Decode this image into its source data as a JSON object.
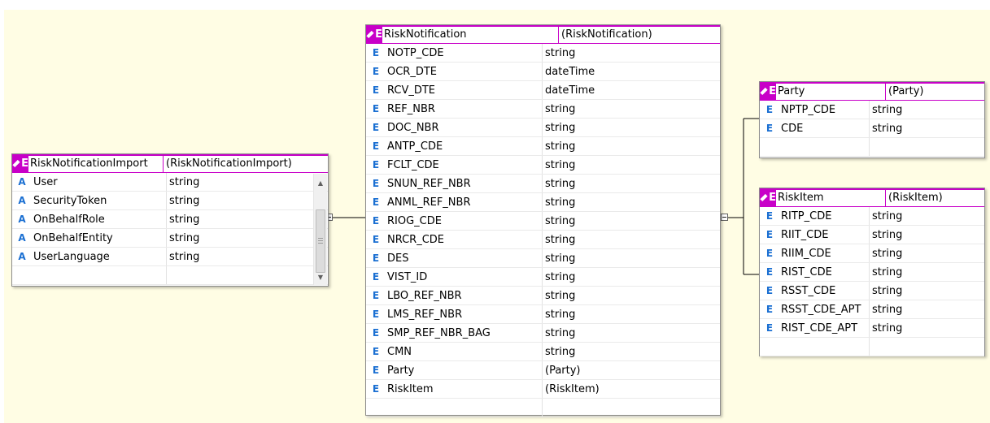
{
  "colors": {
    "canvas": "#fffde4",
    "header": "#c800c8",
    "element_icon": "#1a6fd2",
    "attribute_icon": "#1a6fd2"
  },
  "nodes": {
    "import": {
      "header_icon": "E",
      "name": "RiskNotificationImport",
      "type": "(RiskNotificationImport)",
      "rows": [
        {
          "icon": "A",
          "name": "User",
          "type": "string"
        },
        {
          "icon": "A",
          "name": "SecurityToken",
          "type": "string"
        },
        {
          "icon": "A",
          "name": "OnBehalfRole",
          "type": "string"
        },
        {
          "icon": "A",
          "name": "OnBehalfEntity",
          "type": "string"
        },
        {
          "icon": "A",
          "name": "UserLanguage",
          "type": "string"
        }
      ]
    },
    "notification": {
      "header_icon": "E",
      "name": "RiskNotification",
      "type": "(RiskNotification)",
      "rows": [
        {
          "icon": "E",
          "name": "NOTP_CDE",
          "type": "string"
        },
        {
          "icon": "E",
          "name": "OCR_DTE",
          "type": "dateTime"
        },
        {
          "icon": "E",
          "name": "RCV_DTE",
          "type": "dateTime"
        },
        {
          "icon": "E",
          "name": "REF_NBR",
          "type": "string"
        },
        {
          "icon": "E",
          "name": "DOC_NBR",
          "type": "string"
        },
        {
          "icon": "E",
          "name": "ANTP_CDE",
          "type": "string"
        },
        {
          "icon": "E",
          "name": "FCLT_CDE",
          "type": "string"
        },
        {
          "icon": "E",
          "name": "SNUN_REF_NBR",
          "type": "string"
        },
        {
          "icon": "E",
          "name": "ANML_REF_NBR",
          "type": "string"
        },
        {
          "icon": "E",
          "name": "RIOG_CDE",
          "type": "string"
        },
        {
          "icon": "E",
          "name": "NRCR_CDE",
          "type": "string"
        },
        {
          "icon": "E",
          "name": "DES",
          "type": "string"
        },
        {
          "icon": "E",
          "name": "VIST_ID",
          "type": "string"
        },
        {
          "icon": "E",
          "name": "LBO_REF_NBR",
          "type": "string"
        },
        {
          "icon": "E",
          "name": "LMS_REF_NBR",
          "type": "string"
        },
        {
          "icon": "E",
          "name": "SMP_REF_NBR_BAG",
          "type": "string"
        },
        {
          "icon": "E",
          "name": "CMN",
          "type": "string"
        },
        {
          "icon": "E",
          "name": "Party",
          "type": "(Party)"
        },
        {
          "icon": "E",
          "name": "RiskItem",
          "type": "(RiskItem)"
        }
      ]
    },
    "party": {
      "header_icon": "E",
      "name": "Party",
      "type": "(Party)",
      "rows": [
        {
          "icon": "E",
          "name": "NPTP_CDE",
          "type": "string"
        },
        {
          "icon": "E",
          "name": "CDE",
          "type": "string"
        }
      ]
    },
    "riskitem": {
      "header_icon": "E",
      "name": "RiskItem",
      "type": "(RiskItem)",
      "rows": [
        {
          "icon": "E",
          "name": "RITP_CDE",
          "type": "string"
        },
        {
          "icon": "E",
          "name": "RIIT_CDE",
          "type": "string"
        },
        {
          "icon": "E",
          "name": "RIIM_CDE",
          "type": "string"
        },
        {
          "icon": "E",
          "name": "RIST_CDE",
          "type": "string"
        },
        {
          "icon": "E",
          "name": "RSST_CDE",
          "type": "string"
        },
        {
          "icon": "E",
          "name": "RSST_CDE_APT",
          "type": "string"
        },
        {
          "icon": "E",
          "name": "RIST_CDE_APT",
          "type": "string"
        }
      ]
    }
  }
}
